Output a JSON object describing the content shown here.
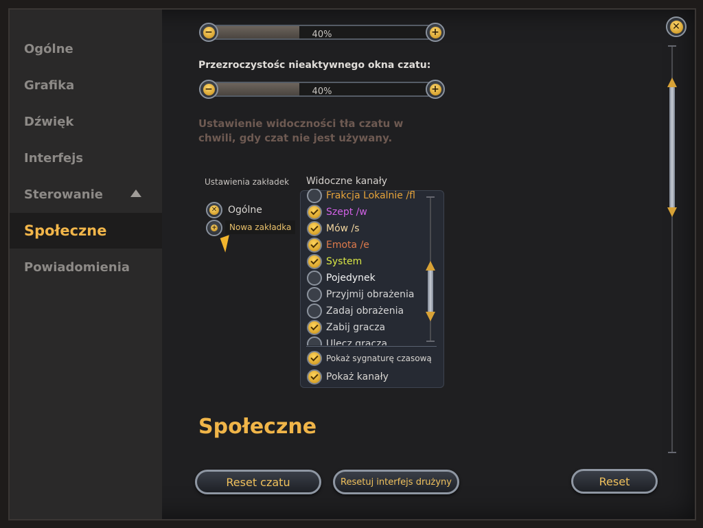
{
  "sidebar": {
    "items": [
      {
        "label": "Ogólne"
      },
      {
        "label": "Grafika"
      },
      {
        "label": "Dźwięk"
      },
      {
        "label": "Interfejs"
      },
      {
        "label": "Sterowanie"
      },
      {
        "label": "Społeczne"
      },
      {
        "label": "Powiadomienia"
      }
    ],
    "active_index": 5
  },
  "settings": {
    "slider_top": {
      "value_text": "40%",
      "value": 0.4
    },
    "inactive_opacity": {
      "label": "Przezroczystośc nieaktywnego okna czatu:",
      "value_text": "40%",
      "value": 0.4
    },
    "description": [
      "Ustawienie widoczności tła czatu w",
      "chwili, gdy czat nie jest używany."
    ],
    "tabs_label": "Ustawienia zakładek",
    "tabs": [
      {
        "label": "Ogólne",
        "icon": "close-icon"
      },
      {
        "label": "Nowa zakładka",
        "icon": "add-icon"
      }
    ],
    "channels_title": "Widoczne kanały",
    "channels": [
      {
        "label": "Frakcja Lokalnie /fl",
        "checked": false,
        "color": "#e7a43a"
      },
      {
        "label": "Szept /w",
        "checked": true,
        "color": "#d262e6"
      },
      {
        "label": "Mów /s",
        "checked": true,
        "color": "#f2d6a0"
      },
      {
        "label": "Emota /e",
        "checked": true,
        "color": "#e07b4c"
      },
      {
        "label": "System",
        "checked": true,
        "color": "#d9e645"
      },
      {
        "label": "Pojedynek",
        "checked": false,
        "color": "#f4f4f4"
      },
      {
        "label": "Przyjmij obrażenia",
        "checked": false,
        "color": "#d6d6d6"
      },
      {
        "label": "Zadaj obrażenia",
        "checked": false,
        "color": "#d6d6d6"
      },
      {
        "label": "Zabij gracza",
        "checked": true,
        "color": "#d6d6d6"
      },
      {
        "label": "Ulecz gracza",
        "checked": false,
        "color": "#d6d6d6"
      }
    ],
    "options": [
      {
        "label": "Pokaż sygnaturę czasową",
        "checked": true
      },
      {
        "label": "Pokaż kanały",
        "checked": true
      }
    ],
    "section_title": "Społeczne"
  },
  "buttons": {
    "reset_chat": "Reset czatu",
    "reset_party": "Resetuj interfejs drużyny",
    "reset": "Reset"
  },
  "colors": {
    "accent": "#f0b549",
    "active_text": "#f2b64a",
    "muted_text": "#8d8a87"
  }
}
